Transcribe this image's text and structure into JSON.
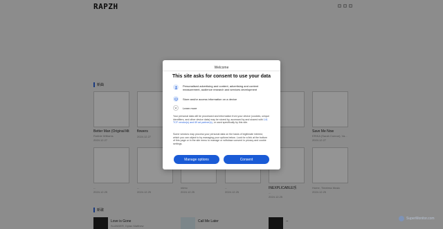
{
  "header": {
    "logo": "RAPZH"
  },
  "sections": {
    "first": {
      "title": "新曲"
    },
    "second": {
      "title": "新歌"
    }
  },
  "cards": [
    {
      "title": "Better Man (Original Mix...",
      "sub": "Robbie Williams",
      "date": "2024.12.27"
    },
    {
      "title": "flowers",
      "sub": "",
      "date": "2024.12.27"
    },
    {
      "title": "",
      "sub": "",
      "date": ""
    },
    {
      "title": "",
      "sub": "",
      "date": ""
    },
    {
      "title": "Save Me Now",
      "sub": "ERIKA (Sarah Connor), Va...",
      "date": "2024.12.27"
    },
    {
      "title": "",
      "sub": "--",
      "date": "2024.12.25"
    },
    {
      "title": "",
      "sub": "--",
      "date": "2024.12.25"
    },
    {
      "title": "",
      "sub": "mimo",
      "date": "2024.12.25"
    },
    {
      "title": "",
      "sub": "--",
      "date": "2024.12.25"
    },
    {
      "title": "INEXPLICABLE乐",
      "sub": "--",
      "date": "2024.12.25"
    },
    {
      "title": "",
      "sub": "Home, Timeless Music",
      "date": "2024.12.25"
    }
  ],
  "songs": [
    {
      "title": "Love is Gone",
      "sub": "SLANDER, Dylan Matthew"
    },
    {
      "title": "Call Me Later",
      "sub": ""
    },
    {
      "title": "--",
      "sub": ""
    }
  ],
  "dialog": {
    "welcome": "Welcome",
    "title": "This site asks for consent to use your data",
    "purposes": [
      {
        "icon": "person-icon",
        "text": "Personalised advertising and content, advertising and content measurement, audience research and services development"
      },
      {
        "icon": "device-icon",
        "text": "Store and/or access information on a device"
      }
    ],
    "learn_more": "Learn more",
    "para1_pre": "Your personal data will be processed and information from your device (cookies, unique identifiers, and other device data) may be stored by, accessed by and shared with ",
    "para1_link": "141 TCF vendor(s) and 69 ad partner(s)",
    "para1_post": ", or used specifically by this site.",
    "para2": "Some vendors may process your personal data on the basis of legitimate interest, which you can object to by managing your options below. Look for a link at the bottom of this page or in the site menu to manage or withdraw consent in privacy and cookie settings.",
    "manage_label": "Manage options",
    "consent_label": "Consent",
    "accent": "#1a5bd6"
  },
  "watermark": {
    "text": "SuperMonitor.com"
  }
}
